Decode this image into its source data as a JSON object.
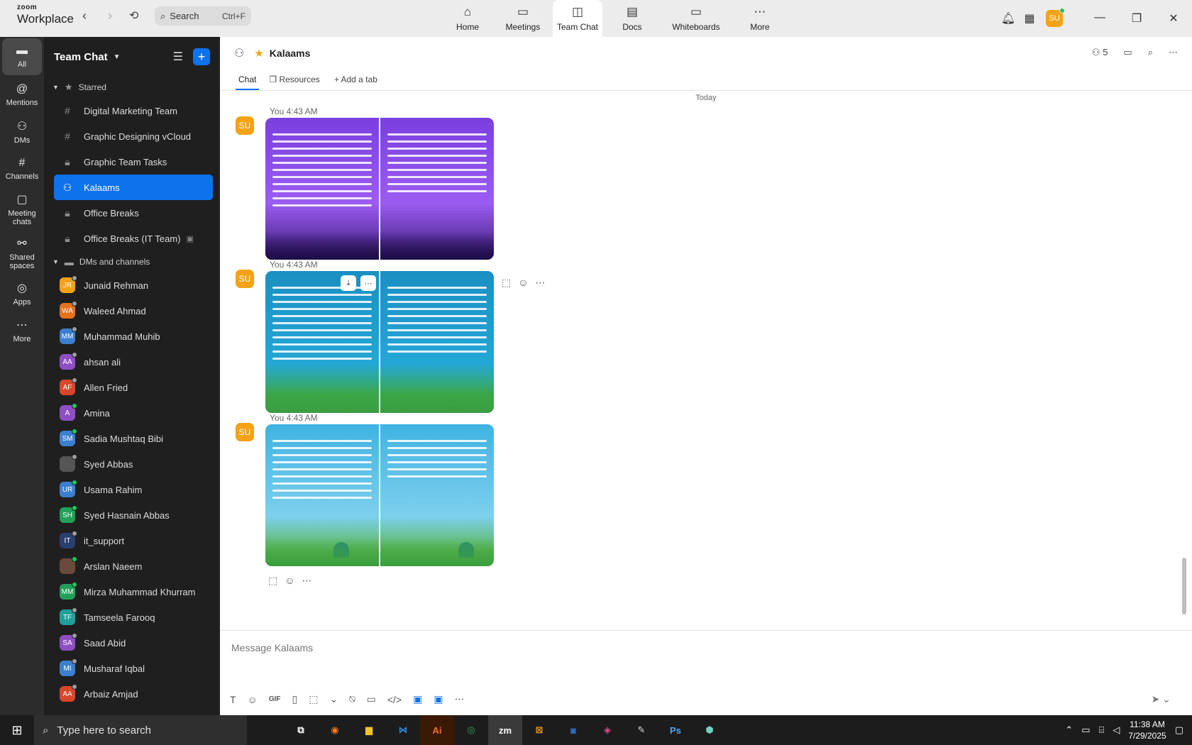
{
  "brand": {
    "line1": "zoom",
    "line2": "Workplace"
  },
  "search": {
    "placeholder": "Search",
    "shortcut": "Ctrl+F"
  },
  "topnav": [
    {
      "label": "Home",
      "icon": "home-icon"
    },
    {
      "label": "Meetings",
      "icon": "video-icon"
    },
    {
      "label": "Team Chat",
      "icon": "chat-icon"
    },
    {
      "label": "Docs",
      "icon": "doc-icon"
    },
    {
      "label": "Whiteboards",
      "icon": "whiteboard-icon"
    },
    {
      "label": "More",
      "icon": "more-icon"
    }
  ],
  "user_initials": "SU",
  "rail": [
    {
      "label": "All"
    },
    {
      "label": "Mentions"
    },
    {
      "label": "DMs"
    },
    {
      "label": "Channels"
    },
    {
      "label": "Meeting chats"
    },
    {
      "label": "Shared spaces"
    },
    {
      "label": "Apps"
    },
    {
      "label": "More"
    }
  ],
  "sidebar": {
    "title": "Team Chat",
    "starred_label": "Starred",
    "channels": [
      {
        "name": "Digital Marketing Team",
        "kind": "hash"
      },
      {
        "name": "Graphic Designing vCloud",
        "kind": "hash"
      },
      {
        "name": "Graphic Team Tasks",
        "kind": "lock"
      },
      {
        "name": "Kalaams",
        "kind": "group"
      },
      {
        "name": "Office Breaks",
        "kind": "lock"
      },
      {
        "name": "Office Breaks (IT Team)",
        "kind": "lock"
      }
    ],
    "dms_label": "DMs and channels",
    "dms": [
      {
        "initials": "JR",
        "name": "Junaid Rehman",
        "color": "#f5a216",
        "status": "#9e9e9e"
      },
      {
        "initials": "WA",
        "name": "Waleed Ahmad",
        "color": "#e8711c",
        "status": "#9e9e9e"
      },
      {
        "initials": "MM",
        "name": "Muhammad Muhib",
        "color": "#3c7fd0",
        "status": "#9e9e9e"
      },
      {
        "initials": "AA",
        "name": "ahsan ali",
        "color": "#8e4fc4",
        "status": "#9e9e9e"
      },
      {
        "initials": "AF",
        "name": "Allen Fried",
        "color": "#d9472b",
        "status": "#9e9e9e"
      },
      {
        "initials": "A",
        "name": "Amina",
        "color": "#8e4fc4",
        "status": "#22c55e"
      },
      {
        "initials": "SM",
        "name": "Sadia Mushtaq Bibi",
        "color": "#3c7fd0",
        "status": "#22c55e"
      },
      {
        "initials": "",
        "name": "Syed Abbas",
        "color": "#555555",
        "status": "#9e9e9e"
      },
      {
        "initials": "UR",
        "name": "Usama Rahim",
        "color": "#3c7fd0",
        "status": "#22c55e"
      },
      {
        "initials": "SH",
        "name": "Syed Hasnain Abbas",
        "color": "#22a05a",
        "status": "#22c55e"
      },
      {
        "initials": "IT",
        "name": "it_support",
        "color": "#2b3f6e",
        "status": "#9e9e9e"
      },
      {
        "initials": "",
        "name": "Arslan Naeem",
        "color": "#6a4a3a",
        "status": "#22c55e"
      },
      {
        "initials": "MM",
        "name": "Mirza Muhammad Khurram",
        "color": "#22a05a",
        "status": "#22c55e"
      },
      {
        "initials": "TF",
        "name": "Tamseela Farooq",
        "color": "#1fa09a",
        "status": "#9e9e9e"
      },
      {
        "initials": "SA",
        "name": "Saad Abid",
        "color": "#8e4fc4",
        "status": "#9e9e9e"
      },
      {
        "initials": "MI",
        "name": "Musharaf Iqbal",
        "color": "#3c7fd0",
        "status": "#9e9e9e"
      },
      {
        "initials": "AA",
        "name": "Arbaiz Amjad",
        "color": "#d9472b",
        "status": "#9e9e9e"
      }
    ]
  },
  "channel": {
    "name": "Kalaams",
    "member_count": "5",
    "tabs": [
      "Chat",
      "Resources",
      "Add a tab"
    ],
    "date_divider": "Today",
    "messages": [
      {
        "author": "You",
        "time": "4:43 AM",
        "theme": "purple"
      },
      {
        "author": "You",
        "time": "4:43 AM",
        "theme": "teal"
      },
      {
        "author": "You",
        "time": "4:43 AM",
        "theme": "sky"
      }
    ]
  },
  "composer": {
    "placeholder": "Message Kalaams",
    "gif_label": "GIF"
  },
  "taskbar": {
    "search_placeholder": "Type here to search",
    "time": "11:38 AM",
    "date": "7/29/2025",
    "apps": [
      "Ai",
      "zm",
      "Ps"
    ]
  }
}
